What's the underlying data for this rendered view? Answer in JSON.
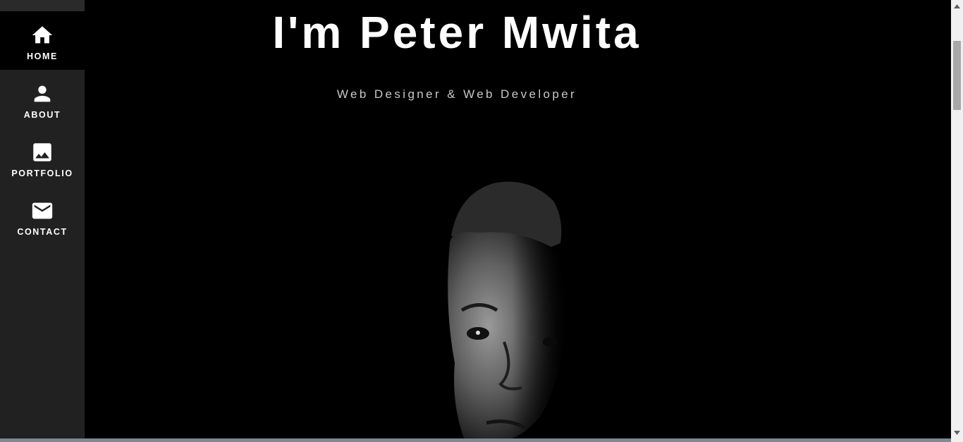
{
  "sidebar": {
    "items": [
      {
        "label": "HOME",
        "icon": "home-icon",
        "active": true
      },
      {
        "label": "ABOUT",
        "icon": "person-icon",
        "active": false
      },
      {
        "label": "PORTFOLIO",
        "icon": "image-icon",
        "active": false
      },
      {
        "label": "CONTACT",
        "icon": "mail-icon",
        "active": false
      }
    ]
  },
  "hero": {
    "title": "I'm Peter Mwita",
    "subtitle": "Web Designer & Web Developer"
  },
  "colors": {
    "sidebar_bg": "#212121",
    "active_bg": "#000000",
    "main_bg": "#000000",
    "text": "#ffffff",
    "subtitle": "#c8c8c8"
  }
}
